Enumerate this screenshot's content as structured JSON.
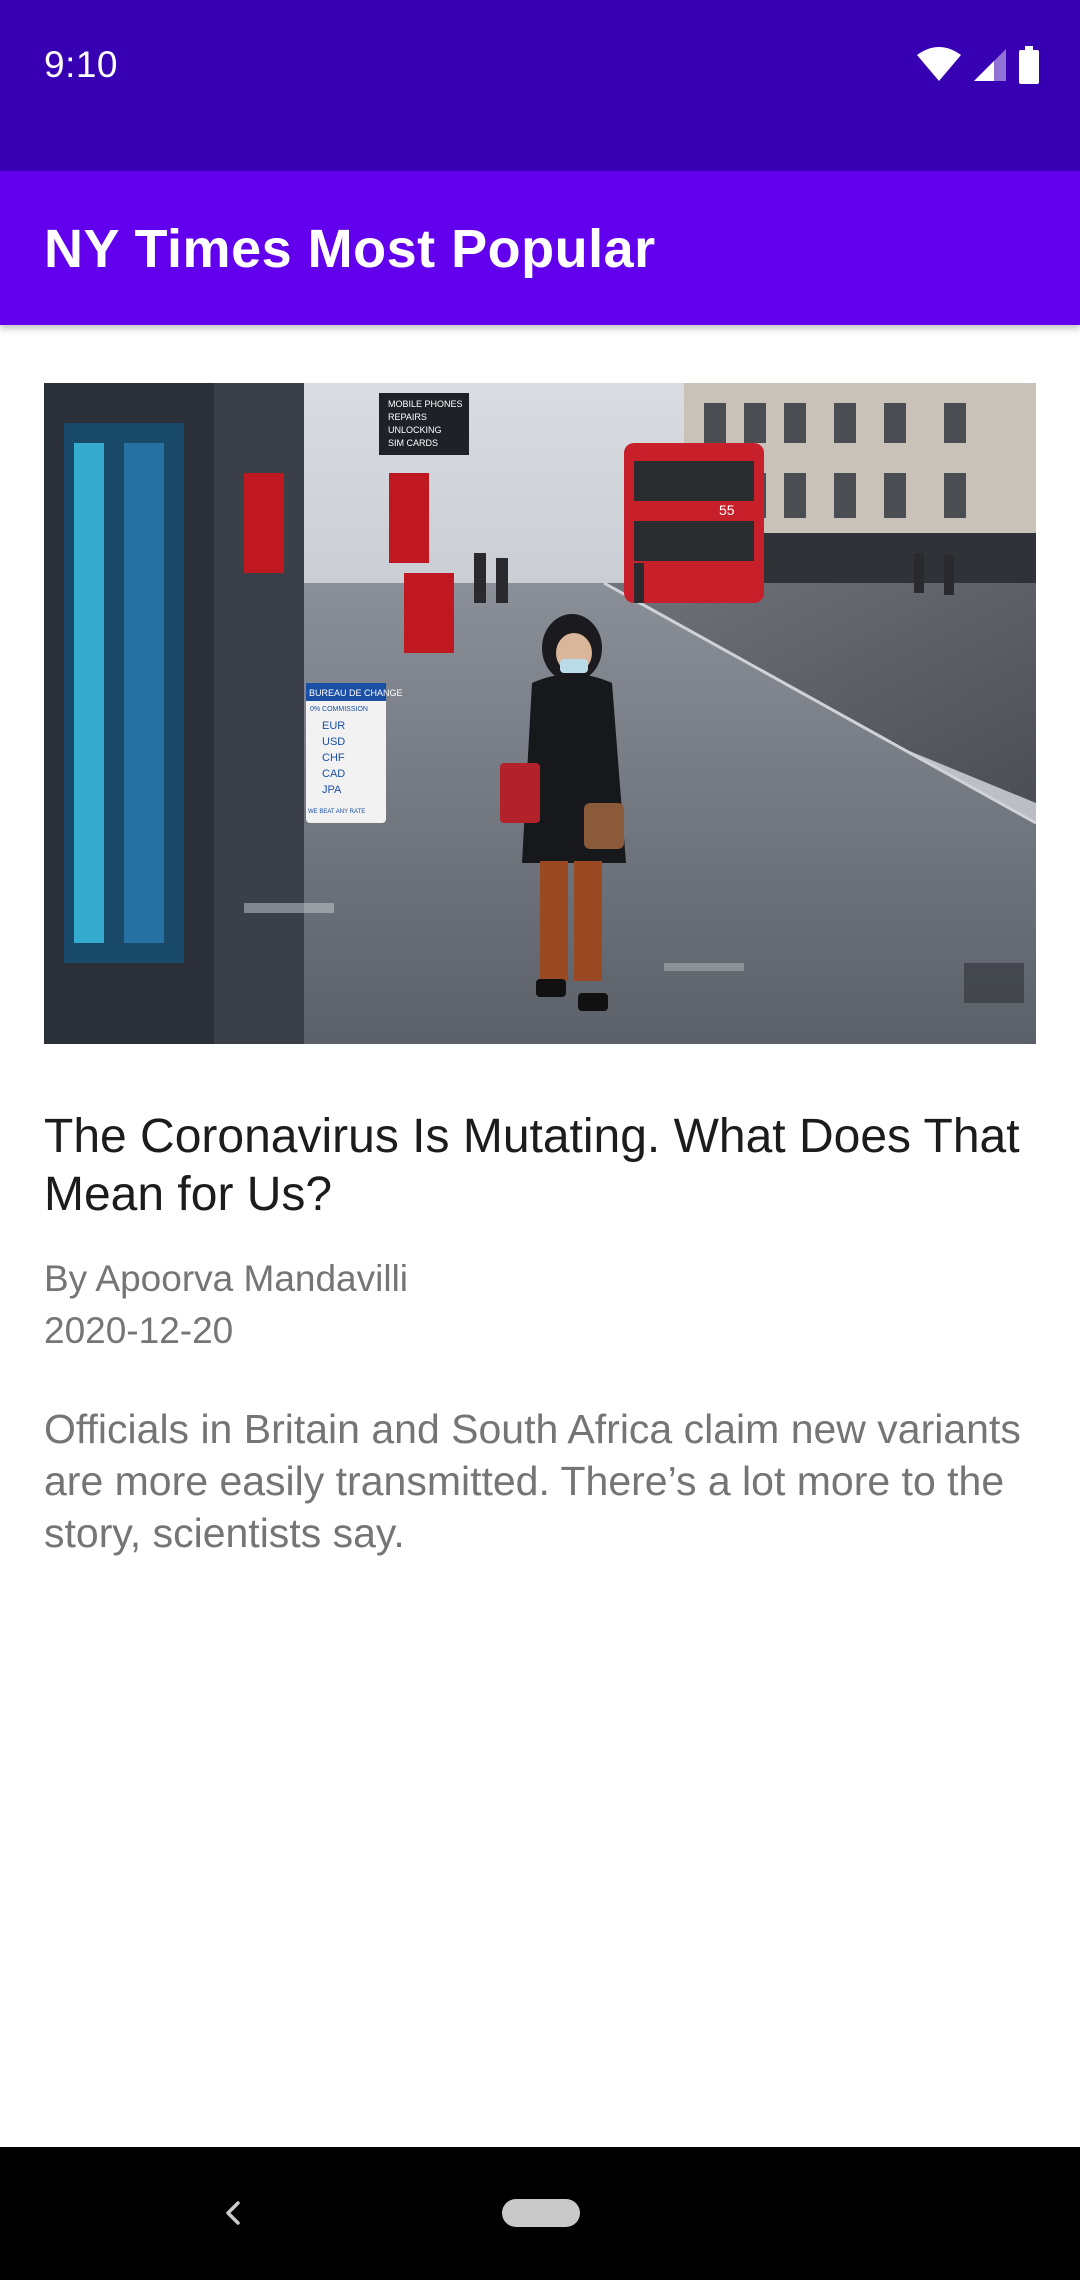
{
  "status_bar": {
    "time": "9:10",
    "icons": [
      "wifi-icon",
      "signal-icon",
      "battery-icon"
    ]
  },
  "app_bar": {
    "title": "NY Times Most Popular"
  },
  "article": {
    "title": "The Coronavirus Is Mutating. What Does That Mean for Us?",
    "byline": "By Apoorva Mandavilli",
    "date": "2020-12-20",
    "abstract": "Officials in Britain and South Africa claim new variants are more easily transmitted. There’s a lot more to the story, scientists say.",
    "image": {
      "shop_signs": [
        "MOBILE PHONES",
        "REPAIRS",
        "UNLOCKING",
        "SIM CARDS"
      ],
      "exchange_board": {
        "heading": "BUREAU DE CHANGE",
        "commission": "0% COMMISSION",
        "currencies": [
          "EUR",
          "USD",
          "CHF",
          "CAD",
          "JPA"
        ],
        "footer": "WE BEAT ANY RATE"
      },
      "bus_route": "55"
    }
  },
  "nav_bar": {
    "icons": [
      "back-icon",
      "home-pill-icon"
    ]
  },
  "colors": {
    "status_bar": "#3700B3",
    "app_bar": "#6200EE",
    "title_text": "#1c1c1c",
    "secondary_text": "#757575"
  }
}
